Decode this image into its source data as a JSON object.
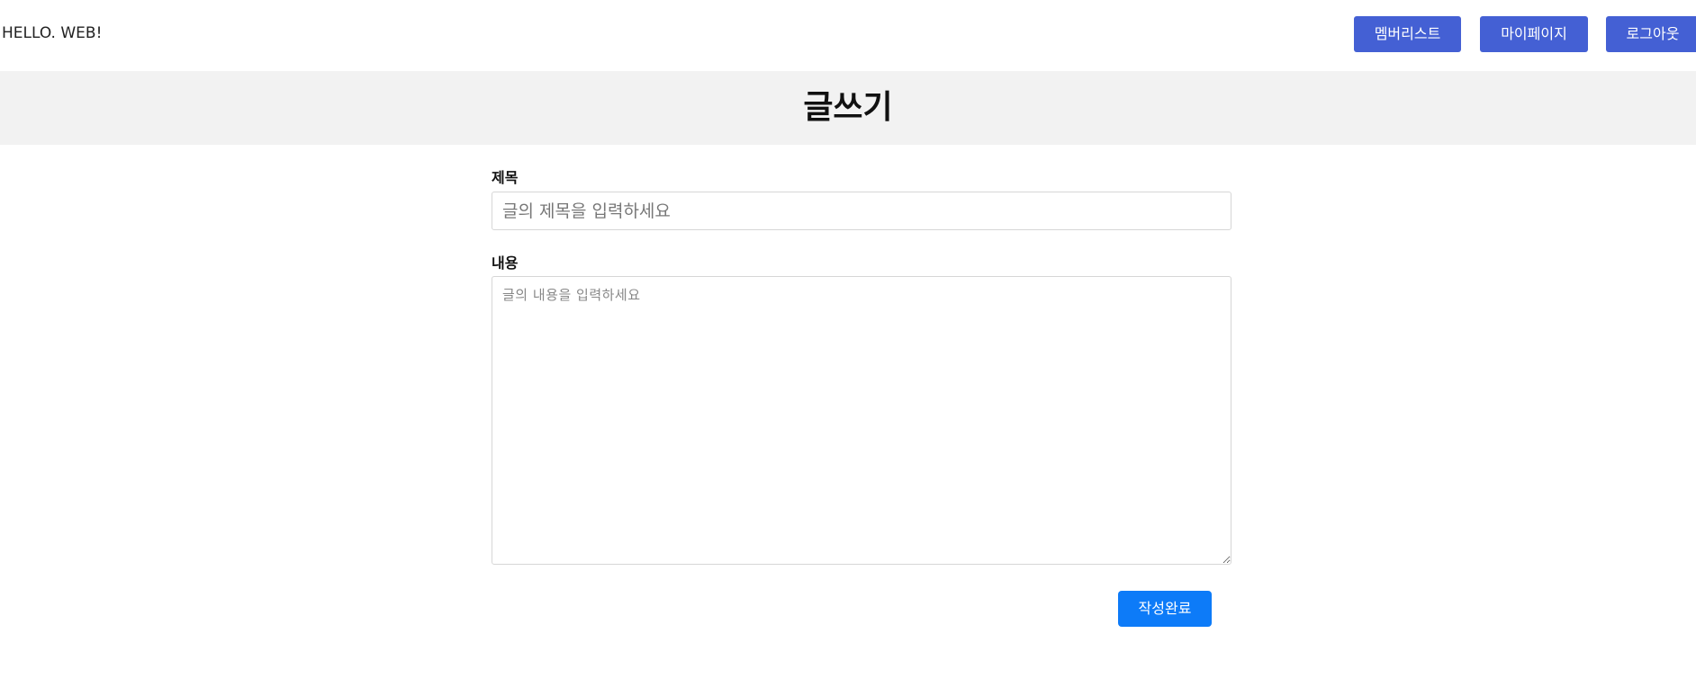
{
  "header": {
    "logo_text": "HELLO. WEB!",
    "nav": {
      "members_label": "멤버리스트",
      "mypage_label": "마이페이지",
      "logout_label": "로그아웃"
    }
  },
  "page": {
    "title": "글쓰기"
  },
  "form": {
    "title_label": "제목",
    "title_placeholder": "글의 제목을 입력하세요",
    "title_value": "",
    "content_label": "내용",
    "content_placeholder": "글의 내용을 입력하세요",
    "content_value": "",
    "submit_label": "작성완료"
  },
  "colors": {
    "nav_button": "#4460d4",
    "submit_button": "#0d7bf8",
    "title_band": "#f2f2f2"
  }
}
